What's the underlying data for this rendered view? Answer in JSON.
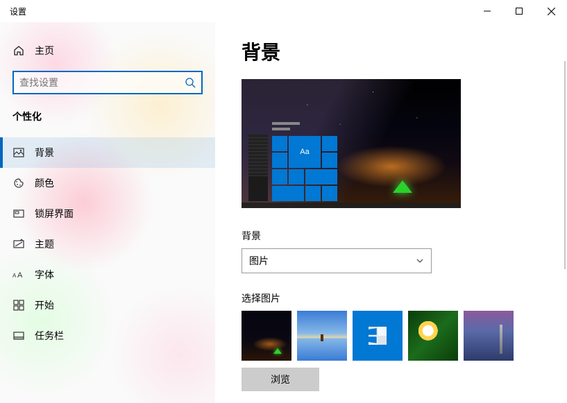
{
  "window": {
    "title": "设置"
  },
  "sidebar": {
    "home": "主页",
    "search_placeholder": "查找设置",
    "category": "个性化",
    "items": [
      {
        "label": "背景",
        "icon": "picture-icon",
        "active": true
      },
      {
        "label": "颜色",
        "icon": "palette-icon"
      },
      {
        "label": "锁屏界面",
        "icon": "lockscreen-icon"
      },
      {
        "label": "主题",
        "icon": "theme-icon"
      },
      {
        "label": "字体",
        "icon": "font-icon"
      },
      {
        "label": "开始",
        "icon": "start-icon"
      },
      {
        "label": "任务栏",
        "icon": "taskbar-icon"
      }
    ]
  },
  "main": {
    "heading": "背景",
    "preview_sample_text": "Aa",
    "bg_label": "背景",
    "bg_dropdown_value": "图片",
    "choose_label": "选择图片",
    "browse_label": "浏览"
  }
}
